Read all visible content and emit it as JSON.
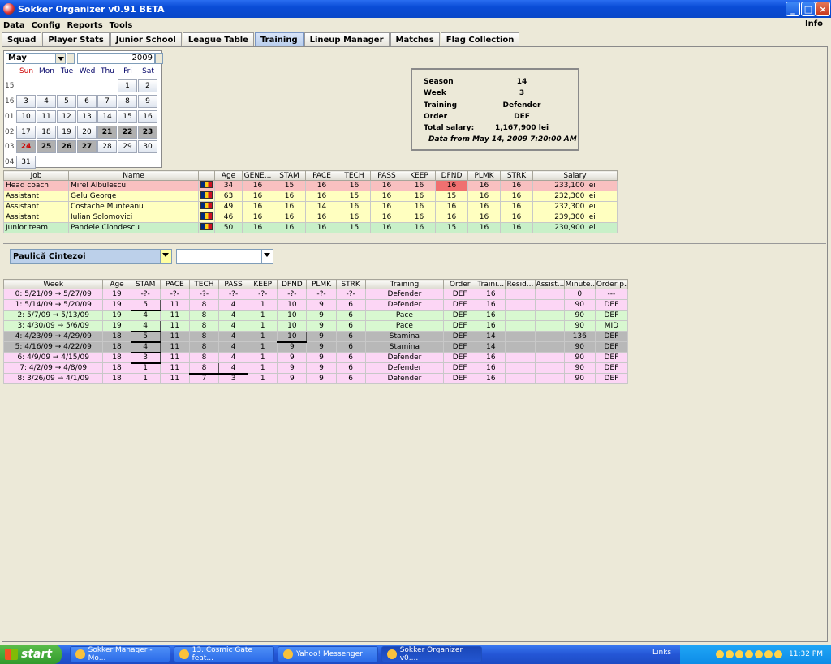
{
  "window": {
    "title": "Sokker Organizer v0.91 BETA"
  },
  "menu": {
    "items": [
      "Data",
      "Config",
      "Reports",
      "Tools"
    ],
    "info": "Info"
  },
  "tabs": [
    "Squad",
    "Player Stats",
    "Junior School",
    "League Table",
    "Training",
    "Lineup Manager",
    "Matches",
    "Flag Collection"
  ],
  "active_tab": "Training",
  "calendar": {
    "month": "May",
    "year": "2009",
    "weekdays": [
      "Sun",
      "Mon",
      "Tue",
      "Wed",
      "Thu",
      "Fri",
      "Sat"
    ],
    "week_numbers": [
      "15",
      "16",
      "01",
      "02",
      "03",
      "04"
    ],
    "rows": [
      [
        "",
        "",
        "",
        "",
        "",
        "1",
        "2"
      ],
      [
        "3",
        "4",
        "5",
        "6",
        "7",
        "8",
        "9"
      ],
      [
        "10",
        "11",
        "12",
        "13",
        "14",
        "15",
        "16"
      ],
      [
        "17",
        "18",
        "19",
        "20",
        "21",
        "22",
        "23"
      ],
      [
        "24",
        "25",
        "26",
        "27",
        "28",
        "29",
        "30"
      ],
      [
        "31",
        "",
        "",
        "",
        "",
        "",
        ""
      ]
    ]
  },
  "info": {
    "season_label": "Season",
    "season": "14",
    "week_label": "Week",
    "week": "3",
    "training_label": "Training",
    "training": "Defender",
    "order_label": "Order",
    "order": "DEF",
    "salary_label": "Total salary:",
    "salary": "1,167,900 lei",
    "data_from": "Data from May 14, 2009 7:20:00 AM"
  },
  "staff": {
    "columns": [
      "Job",
      "Name",
      "",
      "Age",
      "GENE...",
      "STAM",
      "PACE",
      "TECH",
      "PASS",
      "KEEP",
      "DFND",
      "PLMK",
      "STRK",
      "Salary"
    ],
    "rows": [
      {
        "type": "head",
        "cells": [
          "Head coach",
          "Mirel Albulescu",
          "",
          "34",
          "16",
          "15",
          "16",
          "16",
          "16",
          "16",
          "16",
          "16",
          "16",
          "233,100 lei"
        ]
      },
      {
        "type": "asst",
        "cells": [
          "Assistant",
          "Gelu George",
          "",
          "63",
          "16",
          "16",
          "16",
          "15",
          "16",
          "16",
          "15",
          "16",
          "16",
          "232,300 lei"
        ]
      },
      {
        "type": "asst",
        "cells": [
          "Assistant",
          "Costache Munteanu",
          "",
          "49",
          "16",
          "16",
          "14",
          "16",
          "16",
          "16",
          "16",
          "16",
          "16",
          "232,300 lei"
        ]
      },
      {
        "type": "asst",
        "cells": [
          "Assistant",
          "Iulian Solomovici",
          "",
          "46",
          "16",
          "16",
          "16",
          "16",
          "16",
          "16",
          "16",
          "16",
          "16",
          "239,300 lei"
        ]
      },
      {
        "type": "jun",
        "cells": [
          "Junior team",
          "Pandele Clondescu",
          "",
          "50",
          "16",
          "16",
          "16",
          "15",
          "16",
          "16",
          "15",
          "16",
          "16",
          "230,900 lei"
        ]
      }
    ]
  },
  "player_select": {
    "selected": "Paulică Cintezoi",
    "second": ""
  },
  "history": {
    "columns": [
      "Week",
      "Age",
      "STAM",
      "PACE",
      "TECH",
      "PASS",
      "KEEP",
      "DFND",
      "PLMK",
      "STRK",
      "Training",
      "Order",
      "Traini...",
      "Resid...",
      "Assist...",
      "Minute...",
      "Order p..."
    ],
    "rows": [
      {
        "type": "pink",
        "cells": [
          "0:  5/21/09 → 5/27/09",
          "19",
          "-?-",
          "-?-",
          "-?-",
          "-?-",
          "-?-",
          "-?-",
          "-?-",
          "-?-",
          "Defender",
          "DEF",
          "16",
          "",
          "",
          "0",
          "---"
        ]
      },
      {
        "type": "pink",
        "cells": [
          "1:  5/14/09 → 5/20/09",
          "19",
          "5",
          "11",
          "8",
          "4",
          "1",
          "10",
          "9",
          "6",
          "Defender",
          "DEF",
          "16",
          "",
          "",
          "90",
          "DEF"
        ]
      },
      {
        "type": "green",
        "cells": [
          "2:  5/7/09 → 5/13/09",
          "19",
          "4",
          "11",
          "8",
          "4",
          "1",
          "10",
          "9",
          "6",
          "Pace",
          "DEF",
          "16",
          "",
          "",
          "90",
          "DEF"
        ]
      },
      {
        "type": "green",
        "cells": [
          "3:  4/30/09 → 5/6/09",
          "19",
          "4",
          "11",
          "8",
          "4",
          "1",
          "10",
          "9",
          "6",
          "Pace",
          "DEF",
          "16",
          "",
          "",
          "90",
          "MID"
        ]
      },
      {
        "type": "gray",
        "cells": [
          "4:  4/23/09 → 4/29/09",
          "18",
          "5",
          "11",
          "8",
          "4",
          "1",
          "10",
          "9",
          "6",
          "Stamina",
          "DEF",
          "14",
          "",
          "",
          "136",
          "DEF"
        ]
      },
      {
        "type": "gray",
        "cells": [
          "5:  4/16/09 → 4/22/09",
          "18",
          "4",
          "11",
          "8",
          "4",
          "1",
          "9",
          "9",
          "6",
          "Stamina",
          "DEF",
          "14",
          "",
          "",
          "90",
          "DEF"
        ]
      },
      {
        "type": "pink",
        "cells": [
          "6:  4/9/09 → 4/15/09",
          "18",
          "3",
          "11",
          "8",
          "4",
          "1",
          "9",
          "9",
          "6",
          "Defender",
          "DEF",
          "16",
          "",
          "",
          "90",
          "DEF"
        ]
      },
      {
        "type": "pink",
        "cells": [
          "7:  4/2/09 → 4/8/09",
          "18",
          "1",
          "11",
          "8",
          "4",
          "1",
          "9",
          "9",
          "6",
          "Defender",
          "DEF",
          "16",
          "",
          "",
          "90",
          "DEF"
        ]
      },
      {
        "type": "pink",
        "cells": [
          "8:  3/26/09 → 4/1/09",
          "18",
          "1",
          "11",
          "7",
          "3",
          "1",
          "9",
          "9",
          "6",
          "Defender",
          "DEF",
          "16",
          "",
          "",
          "90",
          "DEF"
        ]
      }
    ]
  },
  "taskbar": {
    "start": "start",
    "buttons": [
      "Sokker Manager - Mo...",
      "13. Cosmic Gate feat...",
      "Yahoo! Messenger",
      "Sokker Organizer v0...."
    ],
    "links": "Links",
    "clock": "11:32 PM"
  },
  "colors": {
    "head": "#f8c0c0",
    "assistant": "#ffffc0",
    "junior": "#c8f0c8",
    "pink": "#fcd6f5",
    "green": "#d8f8d0",
    "gray": "#b8b8b8"
  }
}
